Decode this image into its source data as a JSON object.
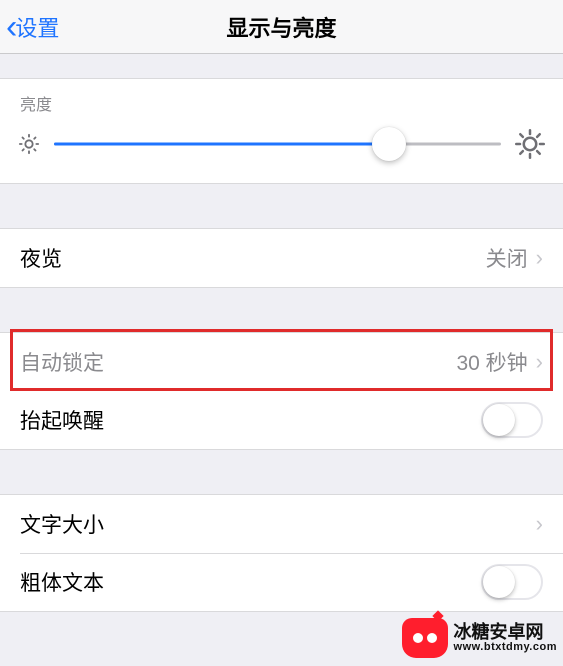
{
  "header": {
    "back_label": "设置",
    "title": "显示与亮度"
  },
  "brightness": {
    "section_label": "亮度",
    "value_percent": 75
  },
  "night_shift": {
    "label": "夜览",
    "value": "关闭"
  },
  "auto_lock": {
    "label": "自动锁定",
    "value": "30 秒钟",
    "highlighted": true
  },
  "raise_to_wake": {
    "label": "抬起唤醒",
    "on": false
  },
  "text_size": {
    "label": "文字大小"
  },
  "bold_text": {
    "label": "粗体文本",
    "on": false
  },
  "brand": {
    "name_cn": "冰糖安卓网",
    "url": "www.btxtdmy.com"
  }
}
